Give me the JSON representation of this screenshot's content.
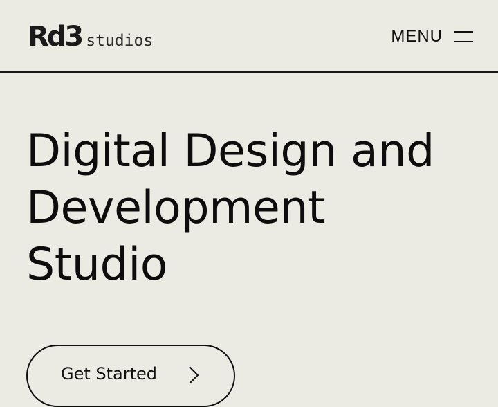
{
  "header": {
    "logo_mark": "Rd3",
    "logo_text": "studios",
    "menu_label": "MENU"
  },
  "hero": {
    "title_lines": [
      "Digital Design and",
      "Development",
      "Studio"
    ],
    "cta_label": "Get Started"
  },
  "icons": {
    "menu": "hamburger-icon",
    "cta": "chevron-right-icon"
  },
  "colors": {
    "background": "#ebeae3",
    "text": "#111111"
  }
}
